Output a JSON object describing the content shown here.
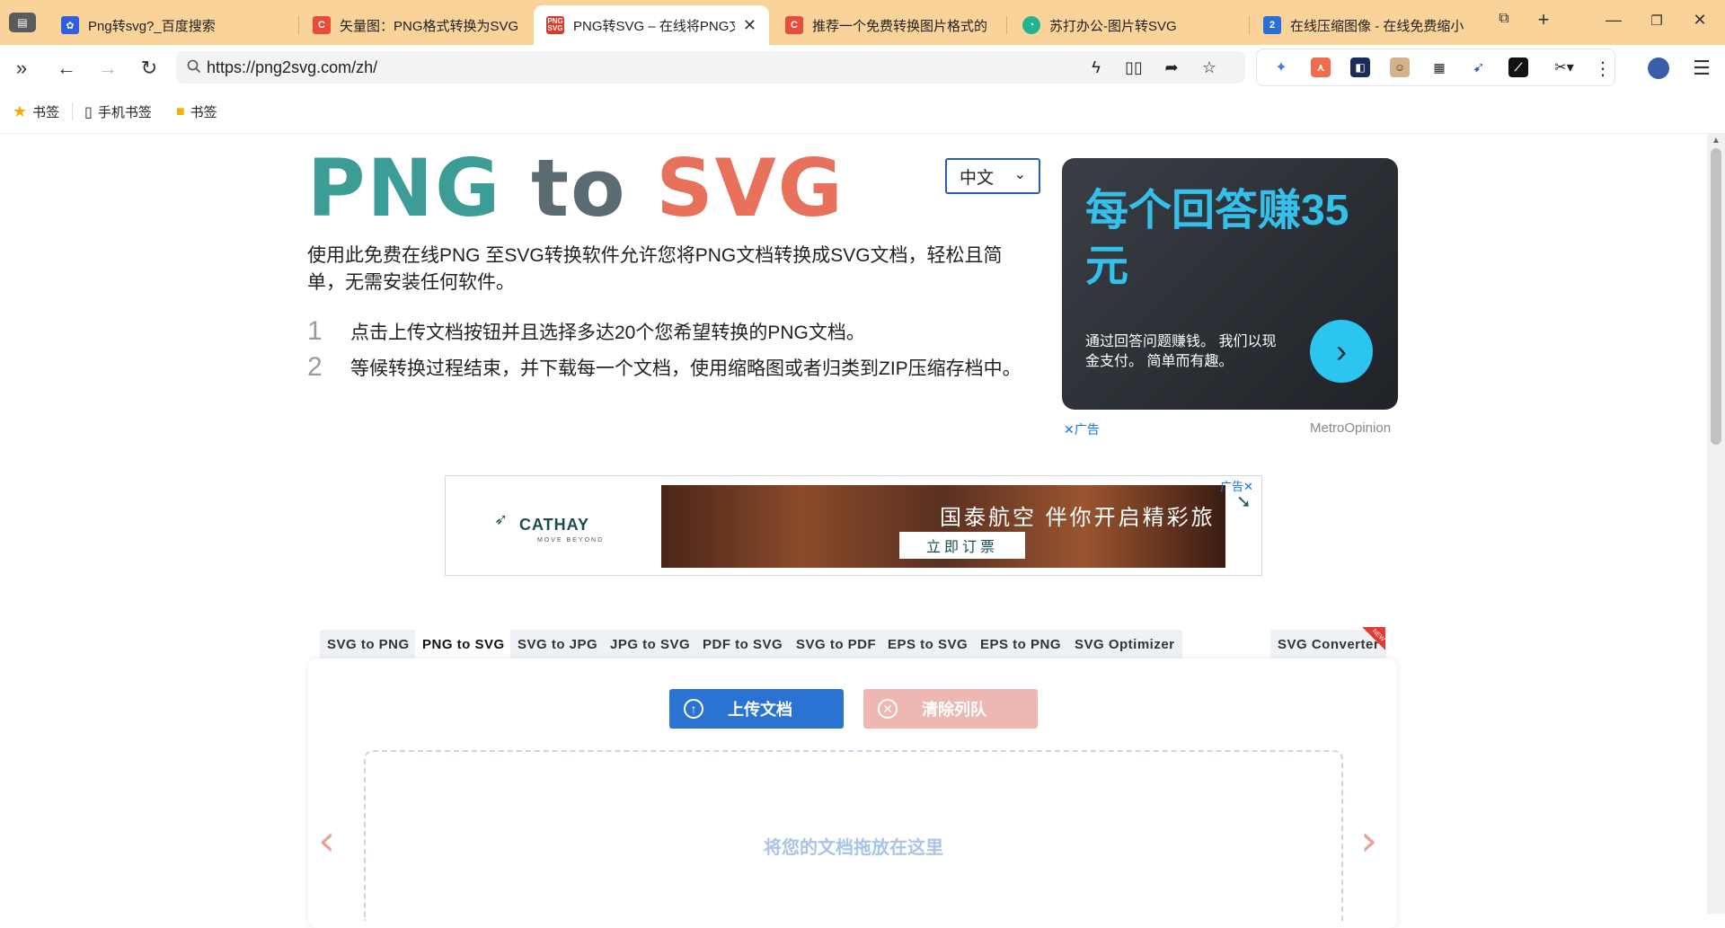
{
  "browser": {
    "tabs": [
      {
        "title": "Png转svg?_百度搜索",
        "favicon": "baidu-paw-icon",
        "color": "#2f5fe0"
      },
      {
        "title": "矢量图：PNG格式转换为SVG",
        "favicon": "c-logo-icon",
        "color": "#e84c3d"
      },
      {
        "title": "PNG转SVG – 在线将PNG文",
        "favicon": "png-svg-icon",
        "color": "#d83b2b"
      },
      {
        "title": "推荐一个免费转换图片格式的",
        "favicon": "c-logo-icon",
        "color": "#e84c3d"
      },
      {
        "title": "苏打办公-图片转SVG",
        "favicon": "soda-icon",
        "color": "#1fb38e"
      },
      {
        "title": "在线压缩图像 - 在线免费缩小",
        "favicon": "number-2-icon",
        "color": "#2a6fd6"
      }
    ],
    "active_tab_index": 2,
    "url": "https://png2svg.com/zh/",
    "bookmarks": [
      "书签",
      "手机书签",
      "书签"
    ]
  },
  "page": {
    "logo": {
      "png": "PNG",
      "to": "to",
      "svg": "SVG"
    },
    "language": "中文",
    "intro": "使用此免费在线PNG 至SVG转换软件允许您将PNG文档转换成SVG文档，轻松且简单，无需安装任何软件。",
    "steps": [
      {
        "num": "1",
        "text": "点击上传文档按钮并且选择多达20个您希望转换的PNG文档。"
      },
      {
        "num": "2",
        "text": "等候转换过程结束，并下载每一个文档，使用缩略图或者归类到ZIP压缩存档中。"
      }
    ],
    "ad_right": {
      "headline": "每个回答赚35元",
      "body": "通过回答问题赚钱。 我们以现金支付。 简单而有趣。",
      "ad_label": "广告",
      "advertiser": "MetroOpinion"
    },
    "banner": {
      "brand": "CATHAY",
      "brand_sub": "MOVE BEYOND",
      "slogan": "国泰航空 伴你开启精彩旅程",
      "cta": "立即订票",
      "ad_label": "广告"
    },
    "converter_tabs": [
      "SVG to PNG",
      "PNG to SVG",
      "SVG to JPG",
      "JPG to SVG",
      "PDF to SVG",
      "SVG to PDF",
      "EPS to SVG",
      "EPS to PNG",
      "SVG Optimizer"
    ],
    "converter_tab_extra": "SVG Converter",
    "new_badge": "NEW",
    "active_converter_tab": 1,
    "upload_button": "上传文档",
    "clear_button": "清除列队",
    "drop_text": "将您的文档拖放在这里"
  }
}
